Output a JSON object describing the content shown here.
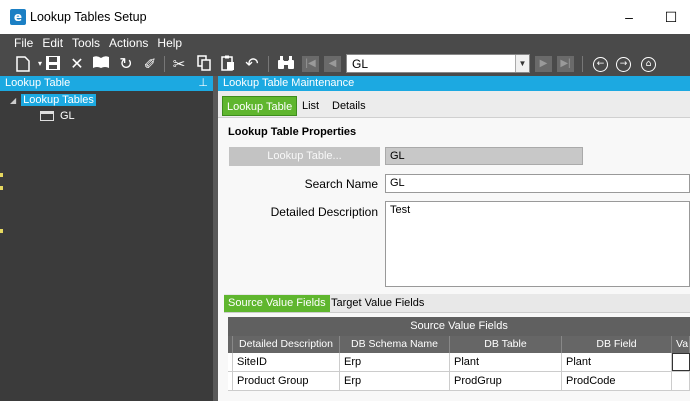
{
  "window": {
    "title": "Lookup Tables Setup",
    "app_icon_letter": "e",
    "minimize_glyph": "–",
    "maximize_glyph": "☐"
  },
  "menu": [
    "File",
    "Edit",
    "Tools",
    "Actions",
    "Help"
  ],
  "toolbar": {
    "record_combo_value": "GL",
    "icons": [
      "new-icon",
      "save-icon",
      "delete-icon",
      "open-book-icon",
      "refresh-icon",
      "clear-icon",
      "cut-icon",
      "copy-icon",
      "paste-icon",
      "undo-icon",
      "binoculars-icon",
      "first-record-icon",
      "previous-record-icon",
      "next-record-icon",
      "last-record-icon",
      "back-icon",
      "forward-icon",
      "home-icon"
    ]
  },
  "left_panel": {
    "header": "Lookup Table",
    "pin_glyph": "⊥",
    "tree_root": "Lookup Tables",
    "tree_child": "GL"
  },
  "right_panel": {
    "header": "Lookup Table Maintenance",
    "tabs": [
      "Lookup Table",
      "List",
      "Details"
    ],
    "section_title": "Lookup Table Properties",
    "lookup_table_button": "Lookup Table...",
    "lookup_table_value": "GL",
    "search_name_label": "Search Name",
    "search_name_value": "GL",
    "description_label": "Detailed Description",
    "description_value": "Test",
    "subtabs": [
      "Source Value Fields",
      "Target Value Fields"
    ],
    "grid": {
      "band_title": "Source Value Fields",
      "columns": [
        "Detailed Description",
        "DB Schema Name",
        "DB Table",
        "DB Field",
        "Va"
      ],
      "rows": [
        [
          "SiteID",
          "Erp",
          "Plant",
          "Plant",
          ""
        ],
        [
          "Product Group",
          "Erp",
          "ProdGrup",
          "ProdCode",
          ""
        ]
      ]
    }
  },
  "colors": {
    "accent_blue": "#1ca9e1",
    "active_tab_green": "#5fb62e",
    "dark_panel": "#3b3b3b"
  }
}
